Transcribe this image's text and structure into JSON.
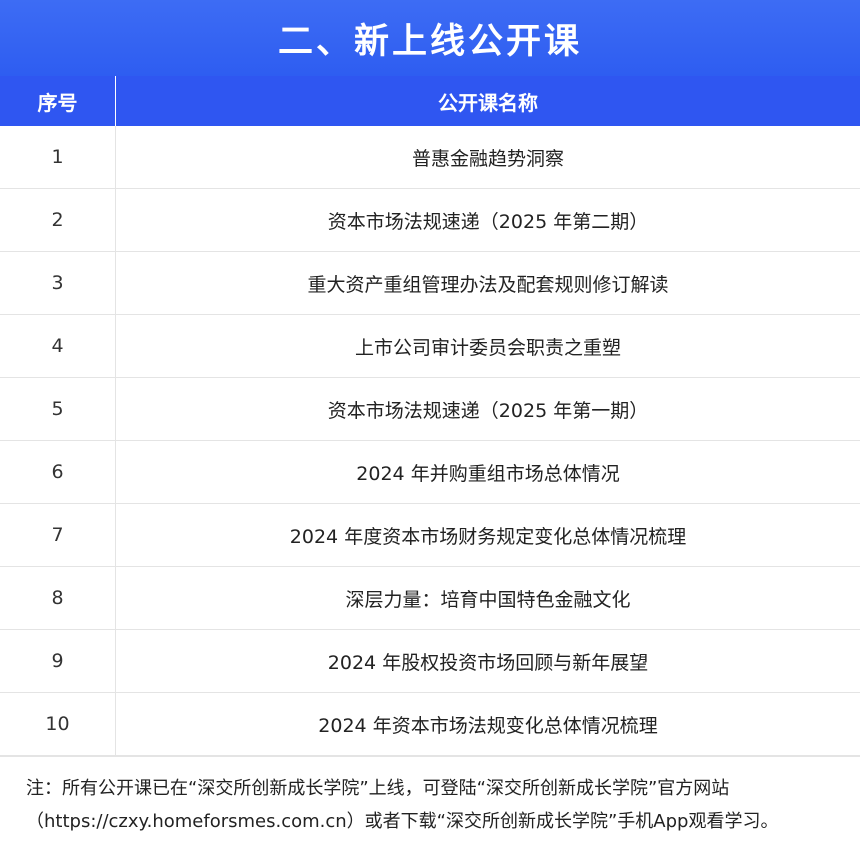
{
  "title": "二、新上线公开课",
  "table": {
    "headers": {
      "no": "序号",
      "name": "公开课名称"
    },
    "rows": [
      {
        "no": "1",
        "name": "普惠金融趋势洞察"
      },
      {
        "no": "2",
        "name": "资本市场法规速递（2025 年第二期）"
      },
      {
        "no": "3",
        "name": "重大资产重组管理办法及配套规则修订解读"
      },
      {
        "no": "4",
        "name": "上市公司审计委员会职责之重塑"
      },
      {
        "no": "5",
        "name": "资本市场法规速递（2025  年第一期）"
      },
      {
        "no": "6",
        "name": "2024 年并购重组市场总体情况"
      },
      {
        "no": "7",
        "name": "2024 年度资本市场财务规定变化总体情况梳理"
      },
      {
        "no": "8",
        "name": "深层力量：培育中国特色金融文化"
      },
      {
        "no": "9",
        "name": "2024 年股权投资市场回顾与新年展望"
      },
      {
        "no": "10",
        "name": "2024 年资本市场法规变化总体情况梳理"
      }
    ]
  },
  "note": "注：所有公开课已在“深交所创新成长学院”上线，可登陆“深交所创新成长学院”官方网站（https://czxy.homeforsmes.com.cn）或者下载“深交所创新成长学院”手机App观看学习。",
  "colors": {
    "title_bg": "#3063f2",
    "header_bg": "#2f56f1",
    "text": "#222222",
    "border": "#e4e4e4"
  }
}
